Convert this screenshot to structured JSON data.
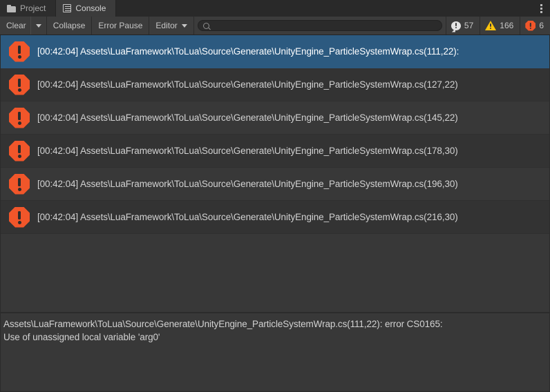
{
  "window": {
    "tabs": [
      {
        "label": "Project",
        "icon": "folder-icon",
        "active": false
      },
      {
        "label": "Console",
        "icon": "console-icon",
        "active": true
      }
    ],
    "menu_icon": "kebab-menu-icon"
  },
  "toolbar": {
    "clear_label": "Clear",
    "clear_dropdown_icon": "chevron-down-icon",
    "collapse_label": "Collapse",
    "error_pause_label": "Error Pause",
    "editor_label": "Editor",
    "editor_dropdown_icon": "chevron-down-icon",
    "search": {
      "icon": "search-icon",
      "value": "",
      "placeholder": ""
    },
    "counters": [
      {
        "type": "info",
        "icon": "info-icon",
        "count": "57",
        "color": "#e4e4e4"
      },
      {
        "type": "warning",
        "icon": "warning-icon",
        "count": "166",
        "color": "#ffc40d"
      },
      {
        "type": "error",
        "icon": "error-icon",
        "count": "6",
        "color": "#f1562a"
      }
    ]
  },
  "log": {
    "entries": [
      {
        "icon": "error-icon",
        "text": "[00:42:04] Assets\\LuaFramework\\ToLua\\Source\\Generate\\UnityEngine_ParticleSystemWrap.cs(111,22):",
        "selected": true
      },
      {
        "icon": "error-icon",
        "text": "[00:42:04] Assets\\LuaFramework\\ToLua\\Source\\Generate\\UnityEngine_ParticleSystemWrap.cs(127,22)",
        "selected": false
      },
      {
        "icon": "error-icon",
        "text": "[00:42:04] Assets\\LuaFramework\\ToLua\\Source\\Generate\\UnityEngine_ParticleSystemWrap.cs(145,22)",
        "selected": false
      },
      {
        "icon": "error-icon",
        "text": "[00:42:04] Assets\\LuaFramework\\ToLua\\Source\\Generate\\UnityEngine_ParticleSystemWrap.cs(178,30)",
        "selected": false
      },
      {
        "icon": "error-icon",
        "text": "[00:42:04] Assets\\LuaFramework\\ToLua\\Source\\Generate\\UnityEngine_ParticleSystemWrap.cs(196,30)",
        "selected": false
      },
      {
        "icon": "error-icon",
        "text": "[00:42:04] Assets\\LuaFramework\\ToLua\\Source\\Generate\\UnityEngine_ParticleSystemWrap.cs(216,30)",
        "selected": false
      }
    ]
  },
  "detail": {
    "line1": "Assets\\LuaFramework\\ToLua\\Source\\Generate\\UnityEngine_ParticleSystemWrap.cs(111,22): error CS0165:",
    "line2": "Use of unassigned local variable 'arg0'"
  },
  "colors": {
    "selection": "#2c5a80",
    "error": "#f1562a",
    "warning": "#ffc40d",
    "info": "#e4e4e4",
    "background": "#383838",
    "row_alt": "#333333"
  }
}
